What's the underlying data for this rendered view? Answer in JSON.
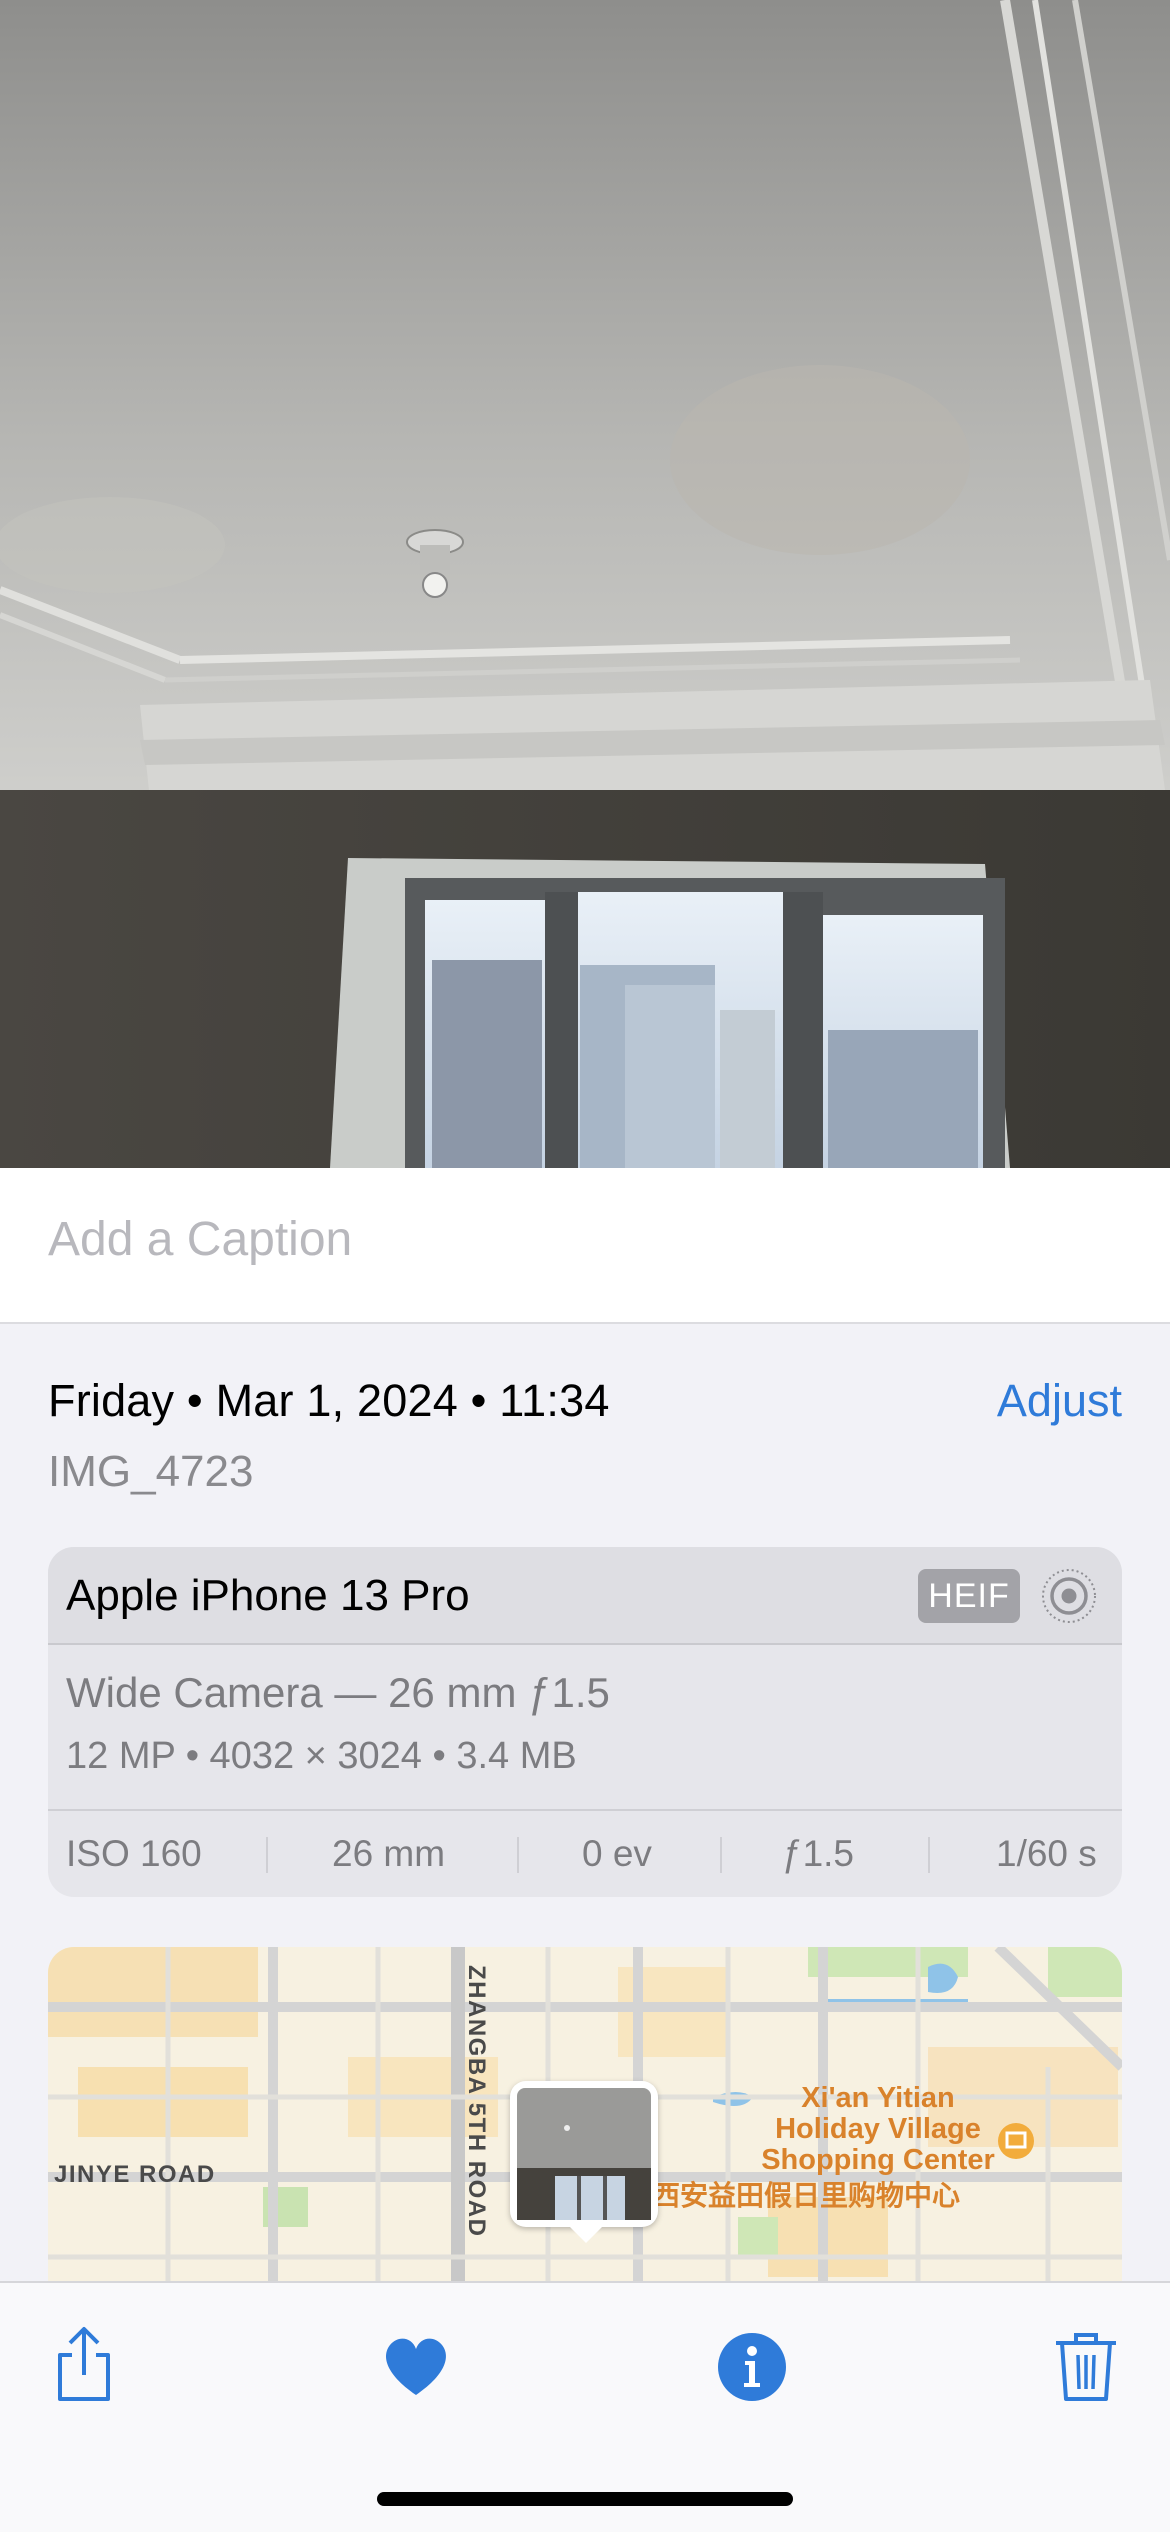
{
  "caption": {
    "placeholder": "Add a Caption"
  },
  "details": {
    "date_line": "Friday • Mar 1, 2024 • 11:34",
    "adjust_label": "Adjust",
    "filename": "IMG_4723"
  },
  "camera_card": {
    "device": "Apple iPhone 13 Pro",
    "format_badge": "HEIF",
    "lens": "Wide Camera — 26 mm ƒ1.5",
    "specs": "12 MP  •  4032 × 3024  •  3.4 MB",
    "exif": {
      "iso": "ISO 160",
      "focal": "26 mm",
      "ev": "0 ev",
      "aperture": "ƒ1.5",
      "shutter": "1/60 s"
    }
  },
  "map": {
    "road_vertical": "ZHANGBA 5TH ROAD",
    "road_horizontal": "JINYE ROAD",
    "poi_line1": "Xi'an Yitian",
    "poi_line2": "Holiday Village",
    "poi_line3": "Shopping Center",
    "poi_cn": "西安益田假日里购物中心"
  },
  "toolbar": {
    "share_icon": "share-icon",
    "favorite_icon": "heart-icon",
    "info_icon": "info-icon",
    "delete_icon": "trash-icon"
  },
  "colors": {
    "accent": "#2f7bd9",
    "background": "#f2f2f7",
    "poi": "#d9822b"
  }
}
